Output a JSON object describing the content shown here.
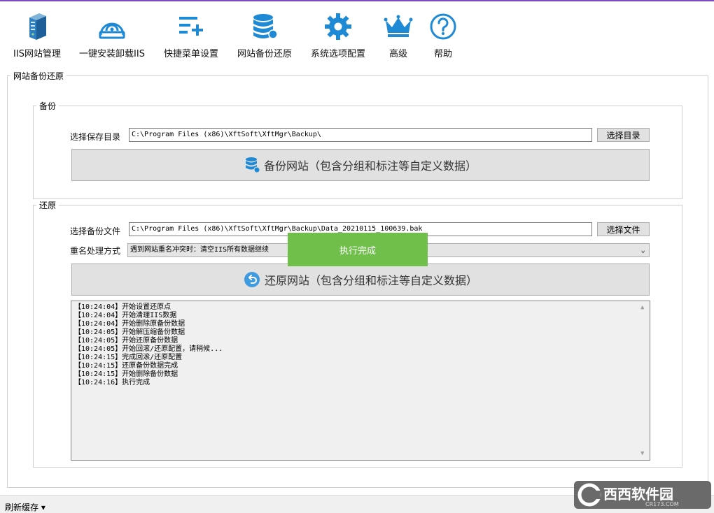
{
  "toolbar": {
    "items": [
      {
        "label": "IIS网站管理",
        "icon": "server-icon"
      },
      {
        "label": "一键安装卸载IIS",
        "icon": "install-icon"
      },
      {
        "label": "快捷菜单设置",
        "icon": "menu-add-icon"
      },
      {
        "label": "网站备份还原",
        "icon": "database-icon"
      },
      {
        "label": "系统选项配置",
        "icon": "gear-icon"
      },
      {
        "label": "高级",
        "icon": "crown-icon"
      },
      {
        "label": "帮助",
        "icon": "help-icon"
      }
    ]
  },
  "main_group": {
    "title": "网站备份还原"
  },
  "backup": {
    "title": "备份",
    "dir_label": "选择保存目录",
    "dir_value": "C:\\Program Files (x86)\\XftSoft\\XftMgr\\Backup\\",
    "choose_dir_btn": "选择目录",
    "backup_btn": "备份网站（包含分组和标注等自定义数据）"
  },
  "restore": {
    "title": "还原",
    "file_label": "选择备份文件",
    "file_value": "C:\\Program Files (x86)\\XftSoft\\XftMgr\\Backup\\Data_20210115_100639.bak",
    "choose_file_btn": "选择文件",
    "rename_label": "重名处理方式",
    "rename_value": "遇到网站重名冲突时：清空IIS所有数据继续",
    "restore_btn": "还原网站（包含分组和标注等自定义数据）"
  },
  "log": {
    "lines": [
      "【10:24:04】开始设置还原点",
      "【10:24:04】开始清理IIS数据",
      "【10:24:04】开始删除原备份数据",
      "【10:24:05】开始解压缩备份数据",
      "【10:24:05】开始还原备份数据",
      "【10:24:05】开始回滚/还原配置，请稍候...",
      "【10:24:15】完成回滚/还原配置",
      "【10:24:15】还原备份数据完成",
      "【10:24:15】开始删除备份数据",
      "【10:24:16】执行完成"
    ]
  },
  "toast": {
    "text": "执行完成"
  },
  "statusbar": {
    "refresh_cache": "刷新缓存 ▾"
  },
  "watermark": {
    "text": "西西软件园",
    "sub": "CR173.COM"
  },
  "colors": {
    "accent": "#1e8ad6",
    "toast": "#6fbf4a",
    "title_border": "#7b4cc2"
  }
}
